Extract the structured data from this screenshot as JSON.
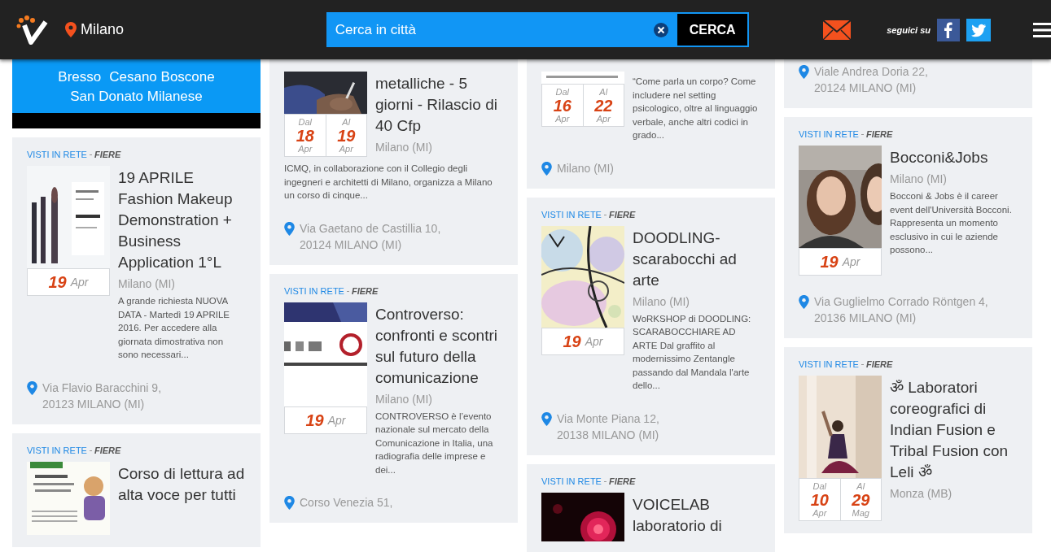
{
  "header": {
    "location": "Milano",
    "search": {
      "placeholder": "Cerca in città"
    },
    "search_button": "CERCA",
    "follow_label": "seguici su"
  },
  "columns": [
    {
      "cards": [
        {
          "kind": "banner",
          "links": [
            "Bresso",
            "Cesano Boscone",
            "San Donato Milanese"
          ]
        },
        {
          "kind": "event",
          "category": "VISTI IN RETE",
          "subcategory": "FIERE",
          "image": {
            "kind": "picture"
          },
          "dates": [
            {
              "day": "19",
              "month": "Apr"
            }
          ],
          "title": "19 APRILE Fashion Makeup Demonstration + Business Application 1°L",
          "city": "Milano (MI)",
          "description": "A grande richiesta NUOVA DATA - Martedì 19 APRILE 2016. Per accedere alla giornata dimostrativa non sono necessari...",
          "address": [
            "Via Flavio Baracchini 9,",
            "20123 MILANO (MI)"
          ]
        },
        {
          "kind": "event",
          "category": "VISTI IN RETE",
          "subcategory": "FIERE",
          "image": {
            "kind": "picture"
          },
          "title": "Corso di lettura ad alta voce per tutti"
        }
      ]
    },
    {
      "cards": [
        {
          "kind": "event_wide",
          "image": {
            "kind": "picture"
          },
          "dates": [
            {
              "label": "Dal",
              "day": "18",
              "month": "Apr"
            },
            {
              "label": "Al",
              "day": "19",
              "month": "Apr"
            }
          ],
          "title": "metalliche - 5 giorni - Rilascio di 40 Cfp",
          "city": "Milano (MI)",
          "description": "ICMQ, in collaborazione con il Collegio degli ingegneri e architetti di Milano, organizza a Milano un corso di cinque...",
          "address": [
            "Via Gaetano de Castillia 10,",
            "20124 MILANO (MI)"
          ]
        },
        {
          "kind": "event",
          "category": "VISTI IN RETE",
          "subcategory": "FIERE",
          "image": {
            "kind": "picture"
          },
          "dates": [
            {
              "day": "19",
              "month": "Apr"
            }
          ],
          "title": "Controverso: confronti e scontri sul futuro della comunicazione",
          "city": "Milano (MI)",
          "description": "CONTROVERSO è l’evento nazionale sul mercato della Comunicazione in Italia, una radiografia delle imprese e dei...",
          "address": [
            "Corso Venezia 51,"
          ]
        }
      ]
    },
    {
      "cards": [
        {
          "kind": "event",
          "image": {
            "kind": "picture"
          },
          "dates": [
            {
              "label": "Dal",
              "day": "16",
              "month": "Apr"
            },
            {
              "label": "Al",
              "day": "22",
              "month": "Apr"
            }
          ],
          "description": "“Come parla un corpo? Come includere nel setting psicologico, oltre al linguaggio verbale, anche altri codici in grado...",
          "address": [
            "Milano (MI)"
          ]
        },
        {
          "kind": "event",
          "category": "VISTI IN RETE",
          "subcategory": "FIERE",
          "image": {
            "kind": "picture"
          },
          "dates": [
            {
              "day": "19",
              "month": "Apr"
            }
          ],
          "title": "DOODLING-scarabocchi ad arte",
          "city": "Milano (MI)",
          "description": "WoRKSHOP di DOODLING: SCARABOCCHIARE AD ARTE Dal graffito al modernissimo Zentangle passando dal Mandala l'arte dello...",
          "address": [
            "Via Monte Piana 12,",
            "20138 MILANO (MI)"
          ]
        },
        {
          "kind": "event",
          "category": "VISTI IN RETE",
          "subcategory": "FIERE",
          "image": {
            "kind": "picture"
          },
          "title": "VOICELAB laboratorio di"
        }
      ]
    },
    {
      "cards": [
        {
          "kind": "event",
          "address": [
            "Viale Andrea Doria 22,",
            "20124 MILANO (MI)"
          ]
        },
        {
          "kind": "event",
          "category": "VISTI IN RETE",
          "subcategory": "FIERE",
          "image": {
            "kind": "picture"
          },
          "dates": [
            {
              "day": "19",
              "month": "Apr"
            }
          ],
          "title": "Bocconi&Jobs",
          "city": "Milano (MI)",
          "description": "Bocconi & Jobs è il career event dell'Università Bocconi. Rappresenta un momento esclusivo in cui le aziende possono...",
          "address": [
            "Via Guglielmo Corrado Röntgen 4,",
            "20136 MILANO (MI)"
          ]
        },
        {
          "kind": "event",
          "category": "VISTI IN RETE",
          "subcategory": "FIERE",
          "image": {
            "kind": "picture"
          },
          "dates": [
            {
              "label": "Dal",
              "day": "10",
              "month": "Apr"
            },
            {
              "label": "Al",
              "day": "29",
              "month": "Mag"
            }
          ],
          "title": "ॐ Laboratori coreografici di Indian Fusion e Tribal Fusion con Leli ॐ",
          "city": "Monza (MB)"
        }
      ]
    }
  ]
}
